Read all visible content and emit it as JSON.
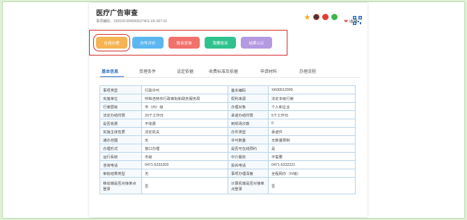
{
  "page": {
    "title": "医疗广告审查",
    "code_label": "事项编码：",
    "code_value": "150100-004600627401-XK-007-01",
    "fav_label": "收藏"
  },
  "buttons": [
    {
      "label": "在线办理",
      "color": "#f6b452"
    },
    {
      "label": "办件评价",
      "color": "#5cb6ef"
    },
    {
      "label": "投诉咨询",
      "color": "#f2716b"
    },
    {
      "label": "我要投诉",
      "color": "#30c28e"
    },
    {
      "label": "结果公示",
      "color": "#b49ae0"
    }
  ],
  "tabs": [
    {
      "label": "基本信息",
      "active": true
    },
    {
      "label": "受理条件",
      "active": false
    },
    {
      "label": "设定依据",
      "active": false
    },
    {
      "label": "收费标准及依据",
      "active": false
    },
    {
      "label": "申请材料",
      "active": false
    },
    {
      "label": "办理流程",
      "active": false
    }
  ],
  "table": [
    [
      "事项类型",
      "行政许可",
      "基本编码",
      "XK00512000"
    ],
    [
      "实施单位",
      "呼和浩特市行政审批和政务服务局",
      "权利来源",
      "法定本级行使"
    ],
    [
      "行使层级",
      "市（州）级",
      "办理对象",
      "个人和企业"
    ],
    [
      "法定办结时限",
      "20个工作日",
      "承诺办结时限",
      "5个工作日"
    ],
    [
      "是否收费",
      "不收费",
      "到现场次数",
      "0"
    ],
    [
      "实施主体性质",
      "法定机关",
      "办件类型",
      "承诺件"
    ],
    [
      "通办范围",
      "无",
      "许可数量",
      "无数量限制"
    ],
    [
      "办理形式",
      "窗口办理",
      "是否可在线预约",
      "是"
    ],
    [
      "运行系统",
      "市级",
      "中介服务",
      "不需要"
    ],
    [
      "咨询电话",
      "0471-5332209",
      "投诉电话",
      "0471-5332221"
    ],
    [
      "审批结果类型",
      "无",
      "事项办理深度",
      "全程网办（IV级）"
    ],
    [
      "移动端是否对接单点登录",
      "否",
      "计算机端是否对接单点登录",
      "否"
    ]
  ]
}
